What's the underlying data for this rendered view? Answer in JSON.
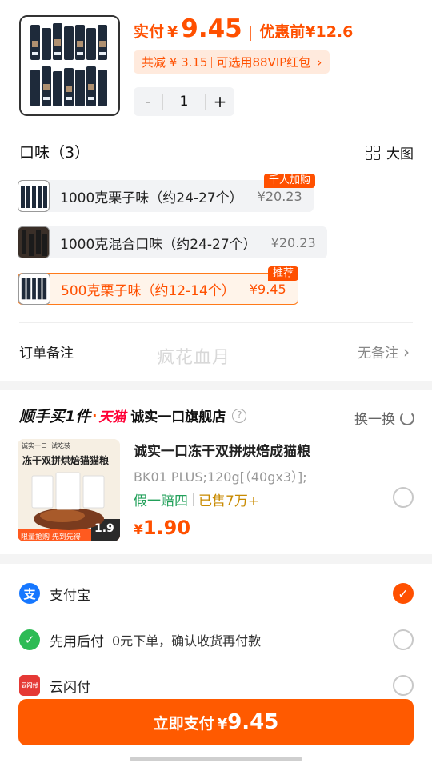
{
  "product": {
    "pay_label": "实付",
    "currency": "¥",
    "pay_amount": "9.45",
    "original_label": "优惠前",
    "original_price": "¥12.6",
    "coupon_text": "共减 ¥ 3.15",
    "coupon_link": "可选用88VIP红包",
    "quantity": "1",
    "minus": "-",
    "plus": "+"
  },
  "flavor": {
    "title": "口味（3）",
    "view_big": "大图",
    "options": [
      {
        "name": "1000克栗子味（约24-27个）",
        "price": "¥20.23",
        "tag": "千人加购"
      },
      {
        "name": "1000克混合口味（约24-27个）",
        "price": "¥20.23"
      },
      {
        "name": "500克栗子味（约12-14个）",
        "price": "¥9.45",
        "tag": "推荐"
      }
    ]
  },
  "order_note": {
    "label": "订单备注",
    "value": "无备注",
    "watermark": "疯花血月"
  },
  "addon": {
    "title": "顺手买1件",
    "tmall": "天猫",
    "shop": "诚实一口旗舰店",
    "help": "?",
    "swap": "换一换",
    "name": "诚实一口冻干双拼烘焙成猫粮",
    "spec": "BK01 PLUS;120g[（40gx3）];",
    "tag_guarantee": "假一赔四",
    "tag_sold": "已售7万+",
    "currency": "¥",
    "price": "1.90",
    "img_banner": "冻干双拼烘焙猫猫粮",
    "img_brand": "诚实一口",
    "img_trial": "试吃装",
    "img_footer": "限量抢购 先到先得",
    "img_price": "1.9"
  },
  "payment": {
    "methods": [
      {
        "name": "支付宝",
        "icon": "alipay-icon",
        "icon_char": "支",
        "color": "#1677ff",
        "selected": true
      },
      {
        "name": "先用后付",
        "desc": "0元下单，确认收货再付款",
        "icon": "pay-later-icon",
        "icon_char": "✓",
        "color": "#2dbb55",
        "selected": false
      },
      {
        "name": "云闪付",
        "icon": "unionpay-icon",
        "icon_char": "云闪付",
        "color": "#e53935",
        "selected": false
      }
    ],
    "button_label": "立即支付",
    "button_currency": "¥",
    "button_amount": "9.45"
  },
  "colors": {
    "accent": "#ff5000",
    "button": "#ff5a00",
    "green": "#22a05a"
  }
}
